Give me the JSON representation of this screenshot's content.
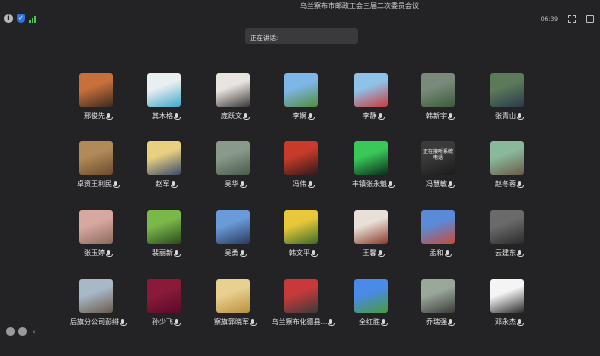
{
  "window": {
    "title": "乌兰察布市邮政工会三届二次委员会议"
  },
  "status": {
    "clock": "06:39"
  },
  "speaking": {
    "label": "正在讲话:"
  },
  "icons": {
    "info": "info-icon",
    "shield": "shield-icon",
    "signal": "signal-icon",
    "fullscreen": "fullscreen-icon",
    "exit": "exit-icon",
    "mic": "mic-icon"
  },
  "participants": [
    {
      "name": "邢俊先",
      "colors": [
        "#c8703a",
        "#3a2a20"
      ]
    },
    {
      "name": "其木格",
      "colors": [
        "#e9eef0",
        "#3fa9c9"
      ]
    },
    {
      "name": "庞跃文",
      "colors": [
        "#e8e4e0",
        "#3a3836"
      ]
    },
    {
      "name": "李婀",
      "colors": [
        "#7fb6e8",
        "#4f8c3a"
      ]
    },
    {
      "name": "李静",
      "colors": [
        "#8fc2e8",
        "#c93a3a"
      ]
    },
    {
      "name": "韩新宇",
      "colors": [
        "#7a8a7a",
        "#3a5a3a"
      ]
    },
    {
      "name": "张青山",
      "colors": [
        "#5a7a5a",
        "#2a3a4a"
      ]
    },
    {
      "name": "卓资王利民",
      "colors": [
        "#b08a58",
        "#6a4a2a"
      ]
    },
    {
      "name": "赵军",
      "colors": [
        "#e8d080",
        "#3a4a6a"
      ]
    },
    {
      "name": "吴华",
      "colors": [
        "#8a9a8a",
        "#4a5a4a"
      ]
    },
    {
      "name": "冯伟",
      "colors": [
        "#c83a2a",
        "#2a1a1a"
      ]
    },
    {
      "name": "丰镇张永魁",
      "colors": [
        "#3ac85a",
        "#0a2a1a"
      ]
    },
    {
      "name": "冯慧敏",
      "colors": [
        "#3a3a3a",
        "#1a1a1a"
      ],
      "caption": "正在接听系统电话"
    },
    {
      "name": "赵冬蓉",
      "colors": [
        "#8ab89a",
        "#6a5a4a"
      ]
    },
    {
      "name": "张玉婷",
      "colors": [
        "#d8a8a0",
        "#8a6a5a"
      ]
    },
    {
      "name": "裴丽新",
      "colors": [
        "#7ab84a",
        "#2a4a1a"
      ]
    },
    {
      "name": "吴勇",
      "colors": [
        "#6a9ad8",
        "#2a3a5a"
      ]
    },
    {
      "name": "韩文平",
      "colors": [
        "#e8c83a",
        "#3a6a2a"
      ]
    },
    {
      "name": "王馨",
      "colors": [
        "#e8e0d8",
        "#8a3a2a"
      ]
    },
    {
      "name": "孟和",
      "colors": [
        "#5a8ad8",
        "#c84a3a"
      ]
    },
    {
      "name": "云建东",
      "colors": [
        "#6a6a6a",
        "#2a2a2a"
      ]
    },
    {
      "name": "后旗分公司彭绯",
      "colors": [
        "#a8b8c8",
        "#6a5a4a"
      ]
    },
    {
      "name": "孙少飞",
      "colors": [
        "#8a1a3a",
        "#5a0a2a"
      ]
    },
    {
      "name": "察旗郭晓军",
      "colors": [
        "#e8d090",
        "#b8903a"
      ]
    },
    {
      "name": "乌兰察布化德县...",
      "colors": [
        "#c83a3a",
        "#3a3a3a"
      ]
    },
    {
      "name": "全红胜",
      "colors": [
        "#4a8ae8",
        "#4a9a3a"
      ]
    },
    {
      "name": "乔瑞强",
      "colors": [
        "#9aa89a",
        "#3a3a3a"
      ]
    },
    {
      "name": "邓永杰",
      "colors": [
        "#f4f4f4",
        "#2a2a2a"
      ]
    }
  ]
}
